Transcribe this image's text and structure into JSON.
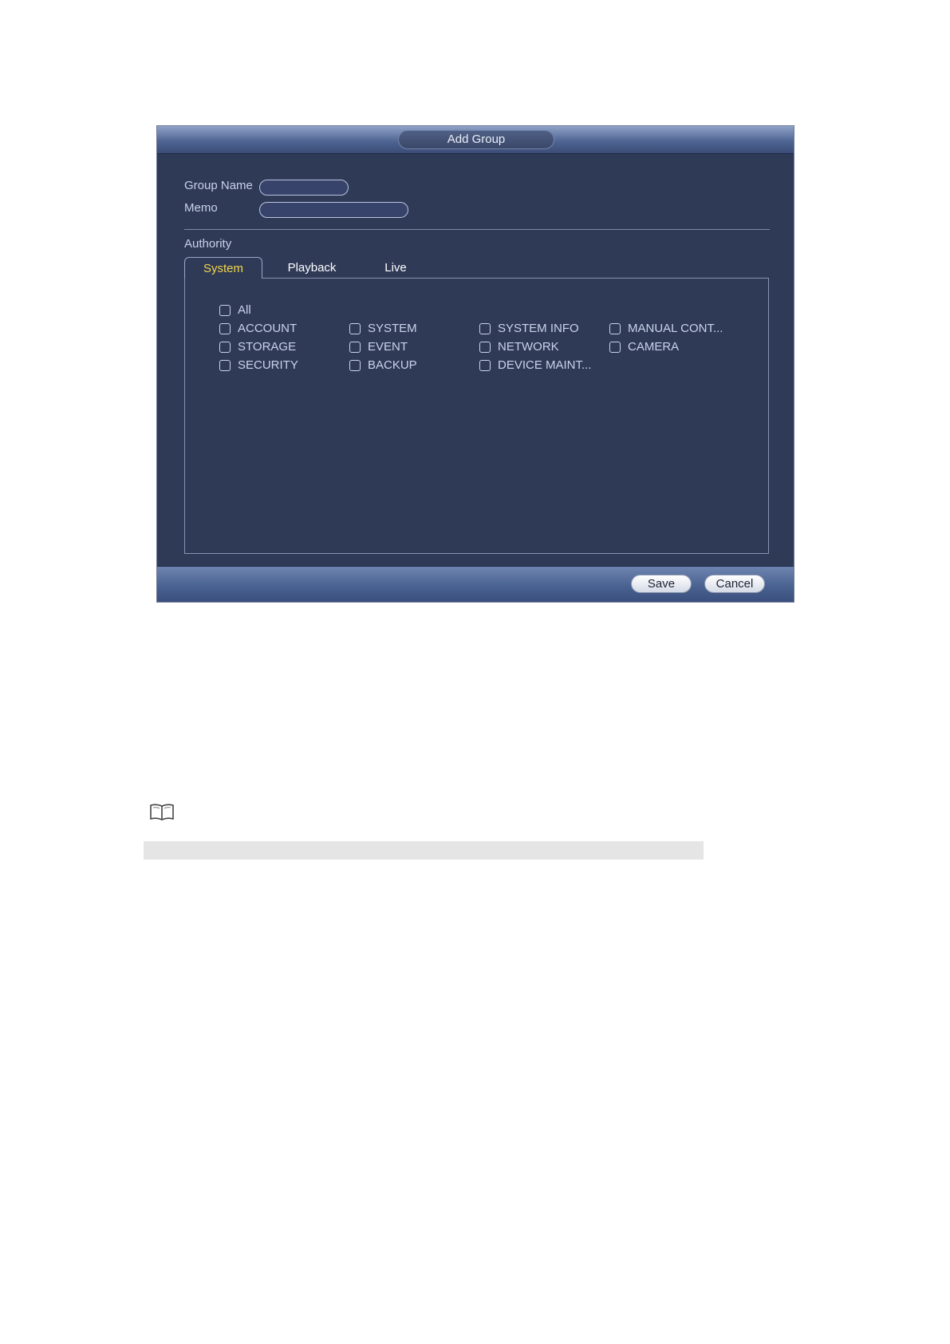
{
  "dialog": {
    "title": "Add Group",
    "group_name_label": "Group Name",
    "memo_label": "Memo",
    "group_name_value": "",
    "memo_value": "",
    "authority_label": "Authority",
    "tabs": [
      {
        "label": "System",
        "active": true
      },
      {
        "label": "Playback",
        "active": false
      },
      {
        "label": "Live",
        "active": false
      }
    ],
    "checkboxes": {
      "all": "All",
      "col1": [
        "ACCOUNT",
        "STORAGE",
        "SECURITY"
      ],
      "col2": [
        "SYSTEM",
        "EVENT",
        "BACKUP"
      ],
      "col3": [
        "SYSTEM INFO",
        "NETWORK",
        "DEVICE MAINT..."
      ],
      "col4": [
        "MANUAL CONT...",
        "CAMERA"
      ]
    },
    "save_label": "Save",
    "cancel_label": "Cancel"
  },
  "note": {
    "icon": "book-icon"
  }
}
